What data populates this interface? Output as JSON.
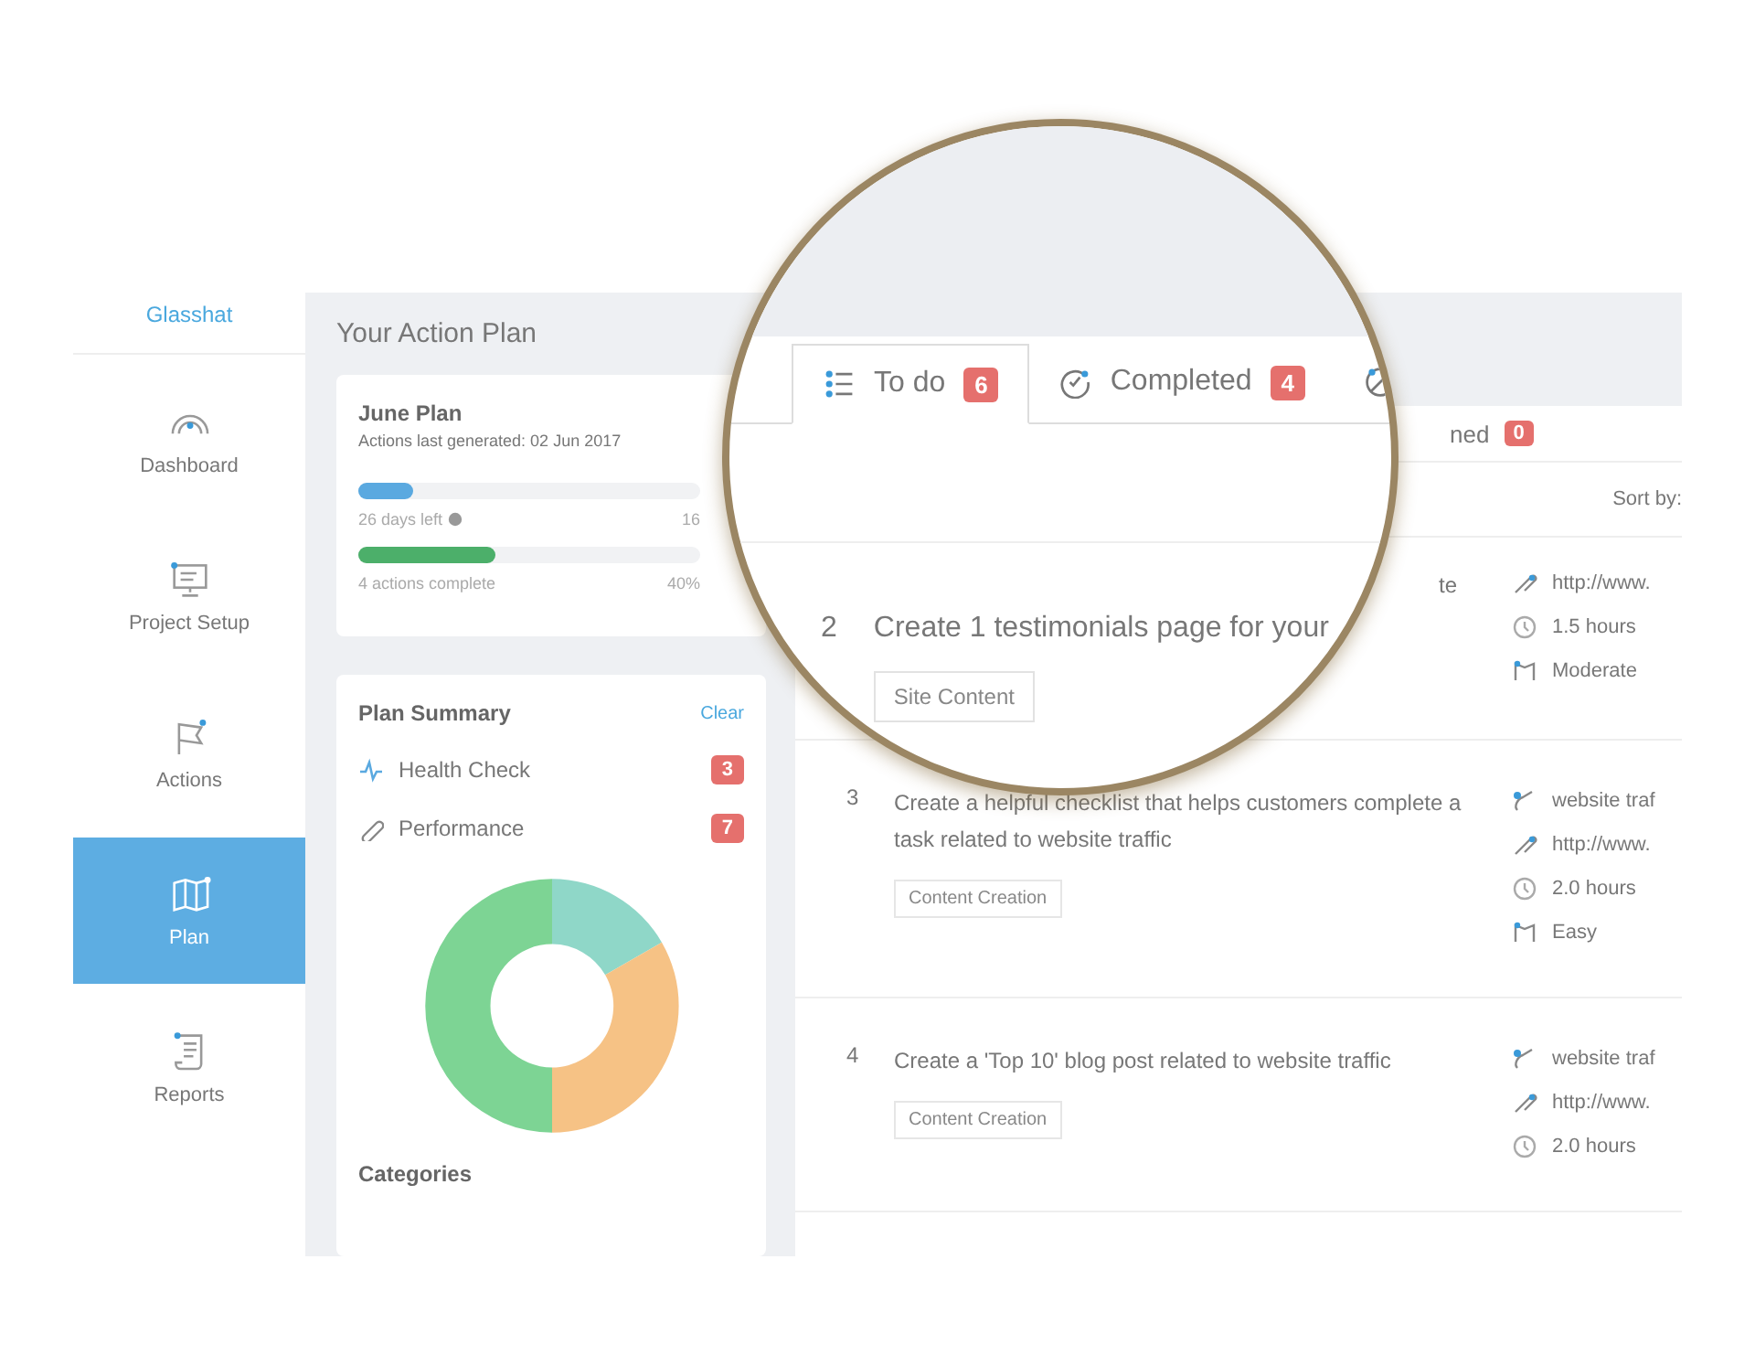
{
  "nav": {
    "logo": "Glasshat",
    "items": [
      {
        "label": "Dashboard",
        "selected": false
      },
      {
        "label": "Project Setup",
        "selected": false
      },
      {
        "label": "Actions",
        "selected": false
      },
      {
        "label": "Plan",
        "selected": true
      },
      {
        "label": "Reports",
        "selected": false
      }
    ]
  },
  "plan_panel": {
    "title": "Your Action Plan",
    "plan_card": {
      "title": "June Plan",
      "subtitle": "Actions last generated: 02 Jun 2017",
      "progress": [
        {
          "kind": "days",
          "level": 0.16,
          "label": "26 days left",
          "value": "16"
        },
        {
          "kind": "actions",
          "level": 0.4,
          "label": "4 actions complete",
          "value": "40%"
        }
      ]
    },
    "summary": {
      "title": "Plan Summary",
      "action": "Clear",
      "items": [
        {
          "label": "Health Check",
          "count": "3"
        },
        {
          "label": "Performance",
          "count": "7"
        }
      ],
      "footer": "Categories"
    }
  },
  "tasks": {
    "outside_tab": {
      "label": "ned",
      "count": "0"
    },
    "sort_label": "Sort by:",
    "rows": [
      {
        "kind": "covered",
        "title": "te",
        "meta": [
          {
            "kind": "link",
            "text": "http://www."
          },
          {
            "kind": "time",
            "text": "1.5 hours"
          },
          {
            "kind": "difficulty",
            "text": "Moderate"
          }
        ]
      },
      {
        "kind": "full",
        "number": "3",
        "title": "Create a helpful checklist that helps customers complete a task related to website traffic",
        "tag": "Content Creation",
        "meta": [
          {
            "kind": "keyword",
            "text": "website traf"
          },
          {
            "kind": "link",
            "text": "http://www."
          },
          {
            "kind": "time",
            "text": "2.0 hours"
          },
          {
            "kind": "difficulty",
            "text": "Easy"
          }
        ]
      },
      {
        "kind": "full",
        "number": "4",
        "title": "Create a 'Top 10' blog post related to website traffic",
        "tag": "Content Creation",
        "meta": [
          {
            "kind": "keyword",
            "text": "website traf"
          },
          {
            "kind": "link",
            "text": "http://www."
          },
          {
            "kind": "time",
            "text": "2.0 hours"
          }
        ]
      }
    ]
  },
  "magnifier": {
    "tabs": [
      {
        "label": "To do",
        "count": "6",
        "selected": true
      },
      {
        "label": "Completed",
        "count": "4",
        "selected": false
      },
      {
        "selected": false
      }
    ],
    "row": {
      "number": "2",
      "title": "Create 1 testimonials page for your",
      "tag": "Site Content"
    }
  }
}
